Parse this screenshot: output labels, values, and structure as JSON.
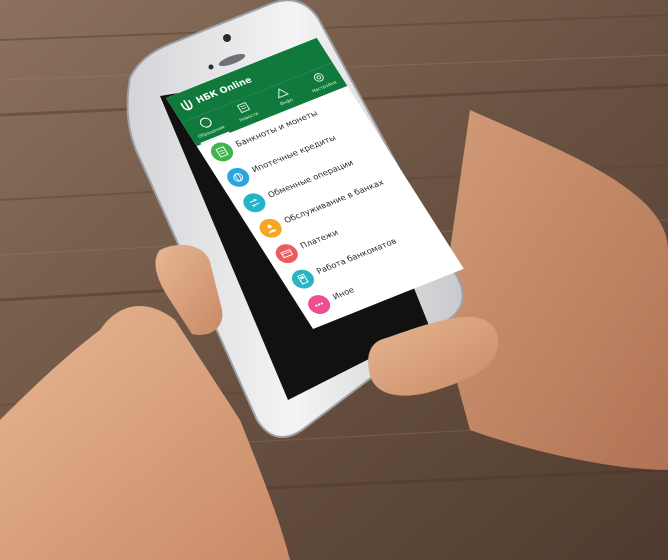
{
  "app": {
    "title": "НБК Online",
    "accent_color": "#0f7a3c",
    "tabs": [
      {
        "label": "Обращения",
        "icon": "chat-bubble-icon"
      },
      {
        "label": "Новости",
        "icon": "newspaper-icon"
      },
      {
        "label": "Инфо",
        "icon": "warning-triangle-icon"
      },
      {
        "label": "Настройки",
        "icon": "gear-icon"
      }
    ],
    "items": [
      {
        "label": "Банкноты и монеты",
        "color": "#3cb54a",
        "icon": "document-icon"
      },
      {
        "label": "Ипотечные кредиты",
        "color": "#29a6e0",
        "icon": "globe-icon"
      },
      {
        "label": "Обменные операции",
        "color": "#22b5c9",
        "icon": "exchange-icon"
      },
      {
        "label": "Обслуживание в банках",
        "color": "#f5a623",
        "icon": "person-icon"
      },
      {
        "label": "Платежи",
        "color": "#ef5a5a",
        "icon": "payment-card-icon"
      },
      {
        "label": "Работа банкоматов",
        "color": "#2bb5c4",
        "icon": "atm-icon"
      },
      {
        "label": "Иное",
        "color": "#ec4f8e",
        "icon": "more-dots-icon"
      }
    ]
  }
}
